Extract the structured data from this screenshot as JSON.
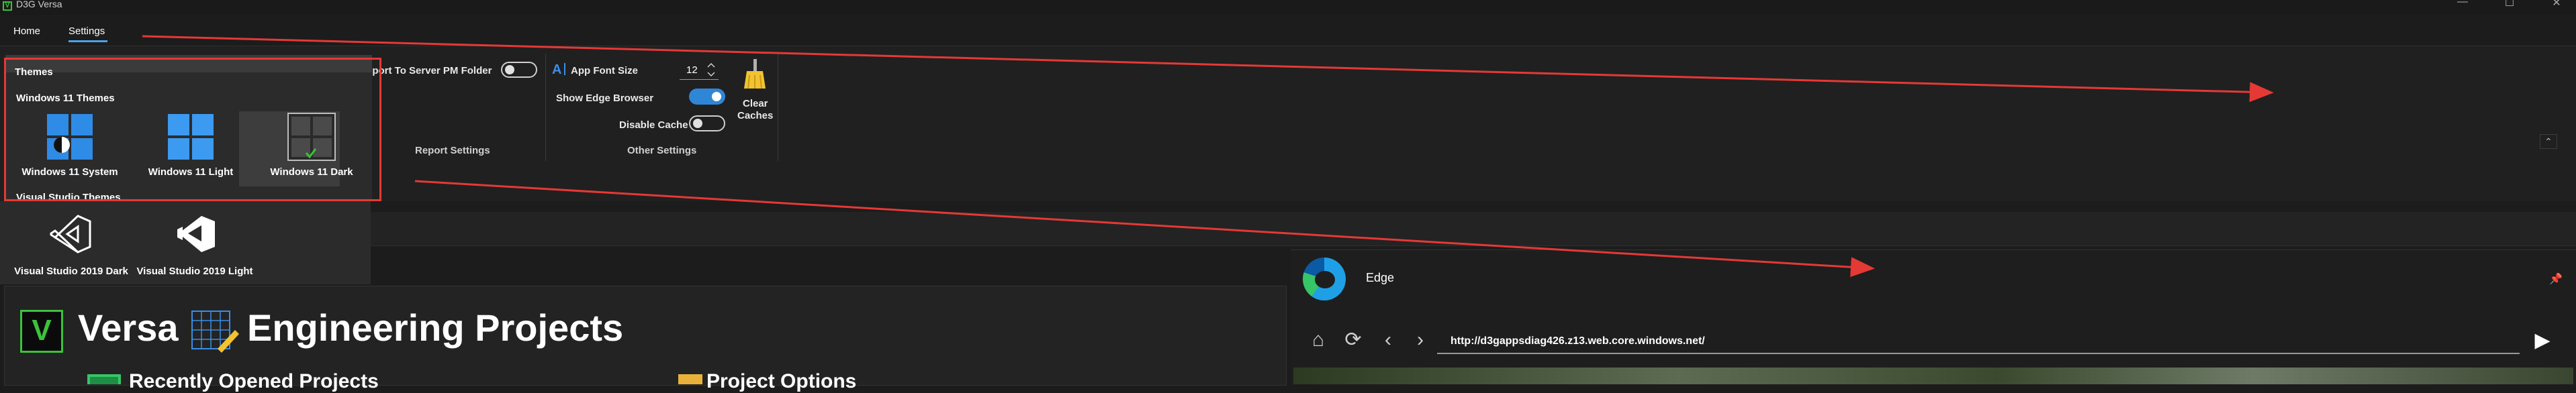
{
  "window": {
    "title": "D3G Versa",
    "app_badge": "V",
    "minimize_glyph": "—",
    "maximize_glyph": "☐",
    "close_glyph": "✕"
  },
  "tabs": [
    {
      "label": "Home"
    },
    {
      "label": "Settings",
      "selected": true
    }
  ],
  "ribbon": {
    "report_settings": {
      "export_toggle_label": "Export To Server PM Folder",
      "export_toggle_on": false,
      "group_label": "Report Settings"
    },
    "other_settings": {
      "app_font_size_label": "App Font Size",
      "app_font_size_value": "12",
      "show_edge_browser_label": "Show Edge Browser",
      "show_edge_browser_on": true,
      "disable_cache_label": "Disable Cache",
      "disable_cache_on": false,
      "group_label": "Other Settings"
    },
    "clear_caches_label_line1": "Clear",
    "clear_caches_label_line2": "Caches",
    "collapse_glyph": "⌃"
  },
  "themes_panel": {
    "header": "Themes",
    "windows_section": "Windows 11 Themes",
    "windows_themes": [
      {
        "label": "Windows 11 System",
        "icon": "windows-system-theme-icon"
      },
      {
        "label": "Windows 11 Light",
        "icon": "windows-light-theme-icon"
      },
      {
        "label": "Windows 11 Dark",
        "icon": "windows-dark-theme-icon",
        "selected": true
      }
    ],
    "vs_section": "Visual Studio Themes",
    "vs_themes": [
      {
        "label": "Visual Studio 2019 Dark",
        "icon": "visual-studio-dark-icon"
      },
      {
        "label": "Visual Studio 2019 Light",
        "icon": "visual-studio-light-icon"
      }
    ]
  },
  "home": {
    "logo_letter": "V",
    "app_name": "Versa",
    "title": "Engineering Projects",
    "recent_heading": "Recently Opened Projects",
    "options_heading": "Project Options"
  },
  "edge": {
    "title": "Edge",
    "url": "http://d3gappsdiag426.z13.web.core.windows.net/",
    "buttons": {
      "home": "⌂",
      "refresh": "⟳",
      "back": "‹",
      "forward": "›",
      "go": "▶"
    }
  },
  "colors": {
    "accent": "#2f86d6",
    "annotation_red": "#e53935",
    "brand_green": "#3cc23c"
  }
}
